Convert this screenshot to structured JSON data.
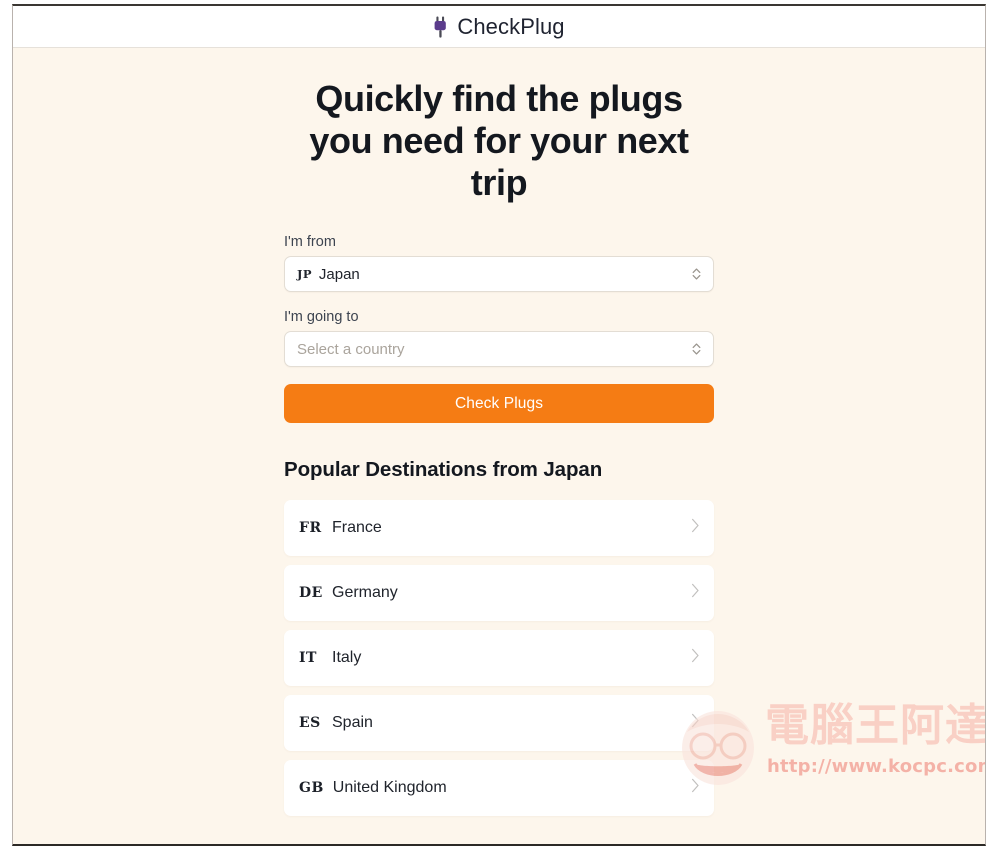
{
  "window": {
    "background_color": "#fdf6ec",
    "top_bar_color": "#ffffff"
  },
  "header": {
    "icon": "plug-icon",
    "icon_color": "#5b3c8c",
    "title": "CheckPlug"
  },
  "hero": {
    "title": "Quickly find the plugs you need for your next trip"
  },
  "form": {
    "from": {
      "label": "I'm from",
      "flag_code": "JP",
      "value": "Japan",
      "caret_icon": "chevron-up-down-icon"
    },
    "to": {
      "label": "I'm going to",
      "placeholder": "Select a country",
      "value": "",
      "caret_icon": "chevron-up-down-icon"
    },
    "submit_label": "Check Plugs",
    "submit_color": "#f57c14"
  },
  "popular": {
    "heading": "Popular Destinations from Japan",
    "items": [
      {
        "flag_code": "FR",
        "name": "France",
        "chevron_icon": "chevron-right-icon"
      },
      {
        "flag_code": "DE",
        "name": "Germany",
        "chevron_icon": "chevron-right-icon"
      },
      {
        "flag_code": "IT",
        "name": "Italy",
        "chevron_icon": "chevron-right-icon"
      },
      {
        "flag_code": "ES",
        "name": "Spain",
        "chevron_icon": "chevron-right-icon"
      },
      {
        "flag_code": "GB",
        "name": "United Kingdom",
        "chevron_icon": "chevron-right-icon"
      }
    ]
  },
  "watermark": {
    "text": "電腦王阿達",
    "url": "http://www.kocpc.com.tw",
    "text_color": "#f8b9ae",
    "url_color": "#f08a7e"
  }
}
